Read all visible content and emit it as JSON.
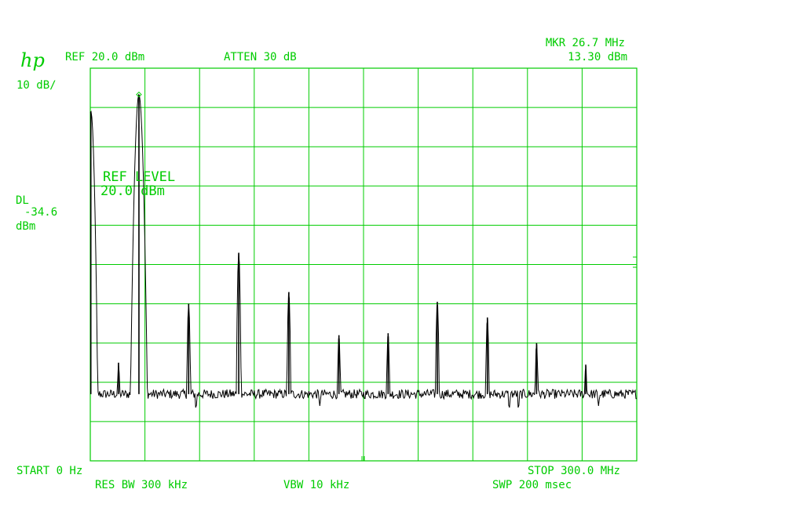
{
  "instrument": {
    "logo_text": "hp",
    "ref_label": "REF 20.0 dBm",
    "atten_label": "ATTEN 30 dB",
    "marker_freq": "MKR 26.7 MHz",
    "marker_level": "13.30 dBm",
    "scale_label": "10 dB/",
    "dl_label": "DL",
    "dl_value": "-34.6",
    "dl_unit": "dBm",
    "ref_level_title": "REF LEVEL",
    "ref_level_value": "20.0 dBm",
    "start_label": "START 0 Hz",
    "stop_label": "STOP 300.0 MHz",
    "res_bw_label": "RES BW 300 kHz",
    "vbw_label": "VBW 10 kHz",
    "swp_label": "SWP 200 msec"
  },
  "colors": {
    "graticule": "#00cc00",
    "text": "#00cc00",
    "trace": "#000000",
    "background": "#ffffff"
  },
  "chart_data": {
    "type": "line",
    "xlim": [
      0,
      300
    ],
    "ylim": [
      -80,
      20
    ],
    "x_units": "MHz",
    "y_units": "dBm",
    "grid": true,
    "noise_floor": -63,
    "marker": {
      "x": 26.7,
      "y": 13.3
    },
    "peaks": [
      {
        "x": 0.3,
        "y": 9.0
      },
      {
        "x": 15.5,
        "y": -55.0
      },
      {
        "x": 26.7,
        "y": 13.3
      },
      {
        "x": 54.0,
        "y": -40.0
      },
      {
        "x": 81.5,
        "y": -27.0
      },
      {
        "x": 109.0,
        "y": -37.0
      },
      {
        "x": 136.5,
        "y": -48.0
      },
      {
        "x": 163.5,
        "y": -47.5
      },
      {
        "x": 190.5,
        "y": -39.5
      },
      {
        "x": 218.0,
        "y": -43.5
      },
      {
        "x": 245.0,
        "y": -50.0
      },
      {
        "x": 272.0,
        "y": -55.5
      }
    ],
    "dips": [
      {
        "x": 58.0,
        "y": -67.0
      },
      {
        "x": 126.0,
        "y": -66.0
      },
      {
        "x": 230.0,
        "y": -67.0
      },
      {
        "x": 235.0,
        "y": -67.0
      },
      {
        "x": 279.0,
        "y": -66.0
      }
    ]
  }
}
